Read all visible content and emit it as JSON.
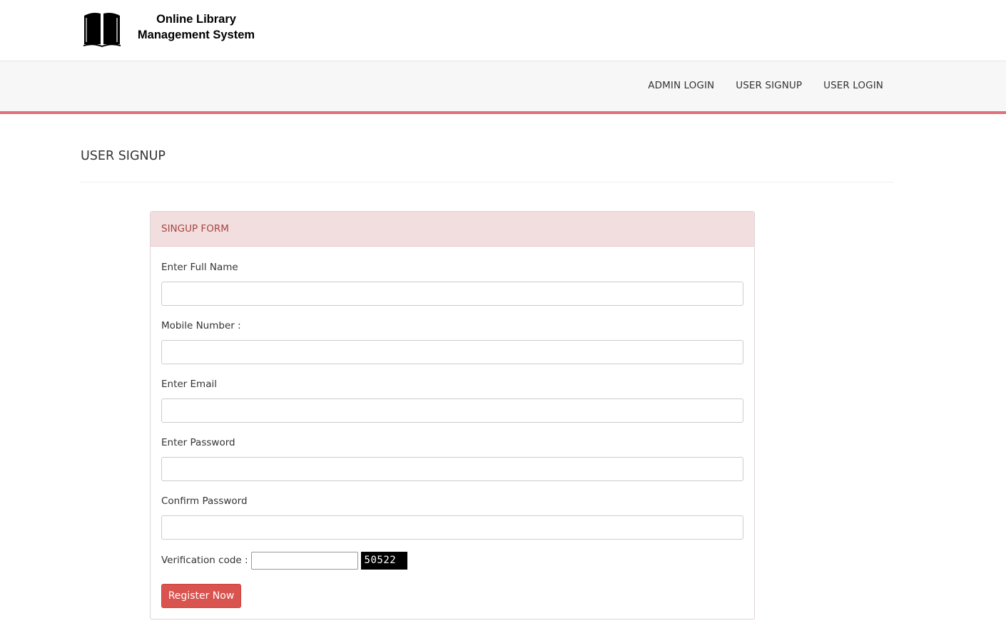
{
  "brand": {
    "line1": "Online Library",
    "line2": "Management System",
    "logo_icon": "open-book-icon"
  },
  "nav": {
    "items": [
      {
        "label": "ADMIN LOGIN"
      },
      {
        "label": "USER SIGNUP"
      },
      {
        "label": "USER LOGIN"
      }
    ]
  },
  "page": {
    "title": "USER SIGNUP"
  },
  "form": {
    "heading": "SINGUP FORM",
    "fields": [
      {
        "label": "Enter Full Name",
        "value": ""
      },
      {
        "label": "Mobile Number :",
        "value": ""
      },
      {
        "label": "Enter Email",
        "value": ""
      },
      {
        "label": "Enter Password",
        "value": ""
      },
      {
        "label": "Confirm Password",
        "value": ""
      }
    ],
    "verification_label": "Verification code :",
    "verification_value": "",
    "captcha_code": "50522",
    "submit_label": "Register Now"
  },
  "colors": {
    "accent_bar": "#e0707a",
    "panel_heading_bg": "#f2dede",
    "panel_heading_text": "#a94442",
    "button_bg": "#d9534f"
  }
}
